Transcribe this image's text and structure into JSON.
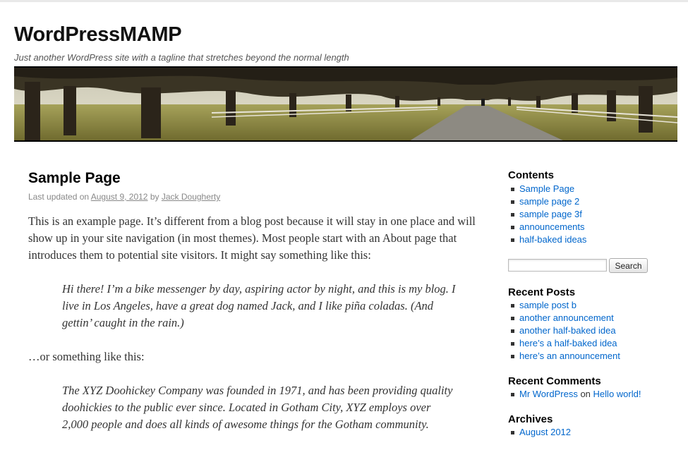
{
  "site": {
    "title": "WordPressMAMP",
    "tagline": "Just another WordPress site with a tagline that stretches beyond the normal length"
  },
  "page": {
    "title": "Sample Page",
    "meta_prefix": "Last updated on",
    "date": "August 9, 2012",
    "by": "by",
    "author": "Jack Dougherty",
    "paragraph1": "This is an example page. It’s different from a blog post because it will stay in one place and will show up in your site navigation (in most themes). Most people start with an About page that introduces them to potential site visitors. It might say something like this:",
    "quote1": "Hi there! I’m a bike messenger by day, aspiring actor by night, and this is my blog. I live in Los Angeles, have a great dog named Jack, and I like piña coladas. (And gettin’ caught in the rain.)",
    "paragraph2": "…or something like this:",
    "quote2": "The XYZ Doohickey Company was founded in 1971, and has been providing quality doohickies to the public ever since. Located in Gotham City, XYZ employs over 2,000 people and does all kinds of awesome things for the Gotham community."
  },
  "sidebar": {
    "contents": {
      "title": "Contents",
      "items": [
        "Sample Page",
        "sample page 2",
        "sample page 3f",
        "announcements",
        "half-baked ideas"
      ]
    },
    "search": {
      "placeholder": "",
      "button_label": "Search"
    },
    "recent_posts": {
      "title": "Recent Posts",
      "items": [
        "sample post b",
        "another announcement",
        "another half-baked idea",
        "here’s a half-baked idea",
        "here’s an announcement"
      ]
    },
    "recent_comments": {
      "title": "Recent Comments",
      "author": "Mr WordPress",
      "on": "on",
      "post": "Hello world!"
    },
    "archives": {
      "title": "Archives",
      "items": [
        "August 2012"
      ]
    }
  },
  "colors": {
    "link": "#0066cc",
    "text": "#333333",
    "header_rule": "#000000"
  },
  "icons": {
    "banner": "tree-lined-road-header-image"
  }
}
